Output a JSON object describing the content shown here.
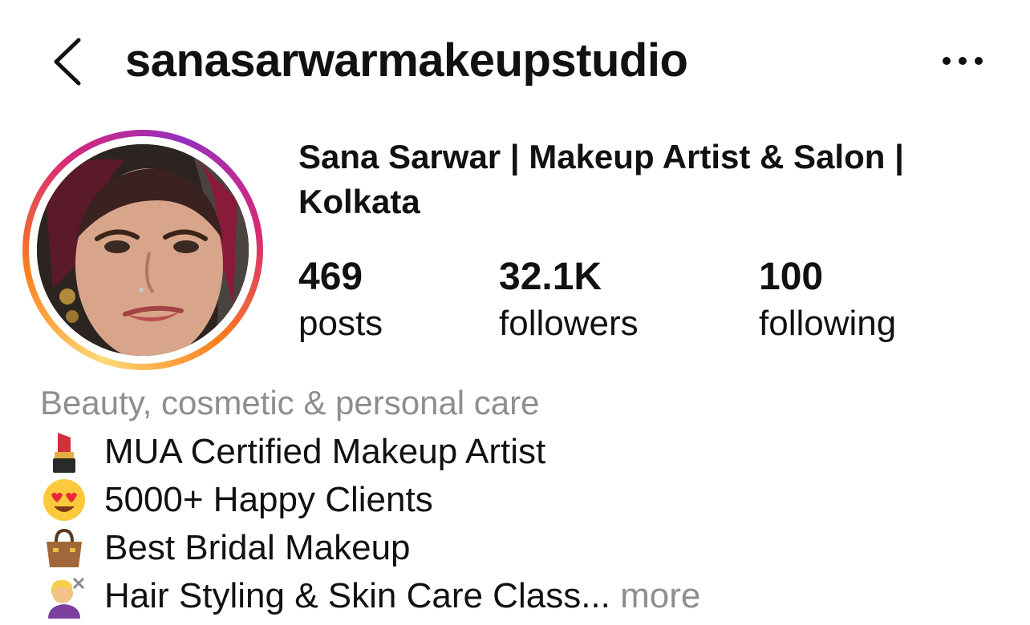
{
  "header": {
    "username": "sanasarwarmakeupstudio",
    "back_icon": "chevron-left-icon",
    "menu_icon": "more-horizontal-icon"
  },
  "profile": {
    "display_name": "Sana Sarwar | Makeup Artist & Salon | Kolkata",
    "avatar_ring_colors": [
      "#feda75",
      "#fa7e1e",
      "#d62976",
      "#962fbf"
    ],
    "stats": {
      "posts": {
        "value": "469",
        "label": "posts"
      },
      "followers": {
        "value": "32.1K",
        "label": "followers"
      },
      "following": {
        "value": "100",
        "label": "following"
      }
    },
    "category": "Beauty, cosmetic & personal care",
    "bio": [
      {
        "icon": "lipstick-icon",
        "text": "MUA Certified Makeup Artist"
      },
      {
        "icon": "heart-eyes-icon",
        "text": "5000+ Happy Clients"
      },
      {
        "icon": "handbag-icon",
        "text": "Best Bridal Makeup"
      },
      {
        "icon": "haircut-icon",
        "text": "Hair Styling & Skin Care Class..."
      }
    ],
    "more_label": "more"
  }
}
